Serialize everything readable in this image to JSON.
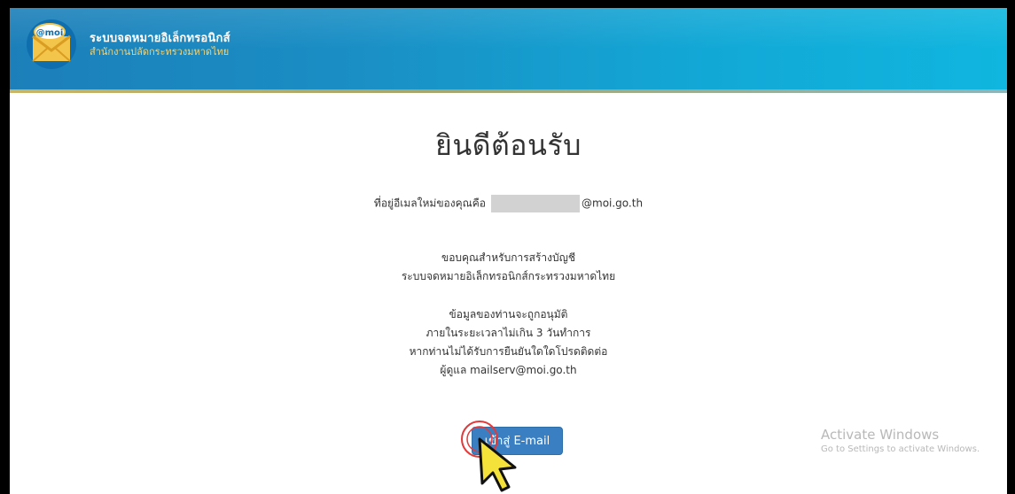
{
  "header": {
    "logo_text": "@moi",
    "title": "ระบบจดหมายอิเล็กทรอนิกส์",
    "subtitle": "สำนักงานปลัดกระทรวงมหาดไทย"
  },
  "main": {
    "heading": "ยินดีต้อนรับ",
    "email_label": "ที่อยู่อีเมลใหม่ของคุณคือ",
    "email_domain": "@moi.go.th",
    "thanks_lines": [
      "ขอบคุณสำหรับการสร้างบัญชี",
      "ระบบจดหมายอิเล็กทรอนิกส์กระทรวงมหาดไทย"
    ],
    "info_lines": [
      "ข้อมูลของท่านจะถูกอนุมัติ",
      "ภายในระยะเวลาไม่เกิน 3 วันทำการ",
      "หากท่านไม่ได้รับการยืนยันใดใดโปรดติดต่อ",
      "ผู้ดูแล mailserv@moi.go.th"
    ],
    "enter_button_label": "เข้าสู่ E-mail"
  },
  "watermark": {
    "title": "Activate Windows",
    "subtitle": "Go to Settings to activate Windows."
  },
  "colors": {
    "header_start": "#1c7fb9",
    "header_end": "#10b6df",
    "button": "#3a7fc2",
    "subtitle_gold": "#f0d47a"
  }
}
